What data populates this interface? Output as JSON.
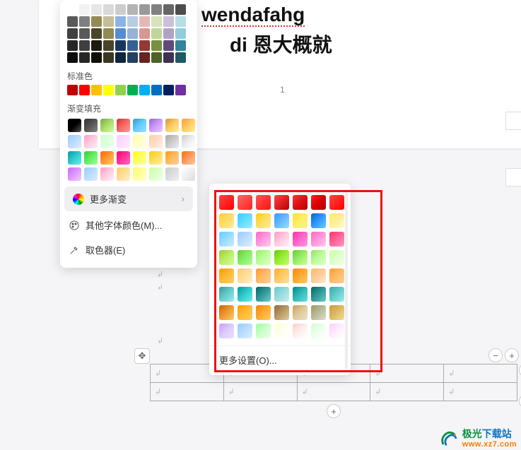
{
  "document": {
    "text1": "wendafahg",
    "text2": "di 恩大概就",
    "page_number": "1"
  },
  "color_panel": {
    "theme_rows": [
      [
        "#ffffff",
        "#f2f2f2",
        "#e6e6e6",
        "#d9d9d9",
        "#cccccc",
        "#b3b3b3",
        "#999999",
        "#808080",
        "#666666",
        "#4d4d4d"
      ],
      [
        "#595959",
        "#7f7f7f",
        "#948a54",
        "#c4bd97",
        "#8db3e2",
        "#b8cce4",
        "#e5b8b7",
        "#d7e3bc",
        "#ccc0d9",
        "#b6dde8"
      ],
      [
        "#404040",
        "#595959",
        "#4a452a",
        "#938953",
        "#548dd4",
        "#95b3d7",
        "#d99694",
        "#c2d69b",
        "#b2a1c7",
        "#92cddc"
      ],
      [
        "#262626",
        "#3f3f3f",
        "#1d1b10",
        "#494429",
        "#17365d",
        "#366092",
        "#953734",
        "#76923c",
        "#5f497a",
        "#31849b"
      ],
      [
        "#0d0d0d",
        "#262626",
        "#0f0e08",
        "#3b3720",
        "#0f243e",
        "#244061",
        "#632423",
        "#4f6228",
        "#3f3151",
        "#205867"
      ]
    ],
    "standard_label": "标准色",
    "standard_colors": [
      "#c00000",
      "#ff0000",
      "#ffc000",
      "#ffff00",
      "#92d050",
      "#00b050",
      "#00b0f0",
      "#0070c0",
      "#002060",
      "#7030a0"
    ],
    "gradient_label": "渐变填充",
    "gradient_presets": [
      [
        "#000",
        "#000",
        "#555"
      ],
      [
        "#333",
        "#555",
        "#888"
      ],
      [
        "#7a4",
        "#ad6",
        "#cf9"
      ],
      [
        "#c33",
        "#f66",
        "#f99"
      ],
      [
        "#39c",
        "#6cf",
        "#9df"
      ],
      [
        "#96c",
        "#c9f",
        "#ecf"
      ],
      [
        "#c93",
        "#fc6",
        "#fe9"
      ],
      [
        "#f93",
        "#fc6",
        "#fe9"
      ],
      [
        "#9cf",
        "#bdf",
        "#def"
      ],
      [
        "#f9c",
        "#fcd",
        "#fef"
      ],
      [
        "#cfc",
        "#dfd",
        "#efe"
      ],
      [
        "#fcf",
        "#fdf",
        "#fef"
      ],
      [
        "#ff9",
        "#ffc",
        "#ffe"
      ],
      [
        "#fc9",
        "#fdc",
        "#fee"
      ],
      [
        "#aaa",
        "#ccc",
        "#eee"
      ],
      [
        "#ccc",
        "#eee",
        "#fff"
      ],
      [
        "#09a",
        "#3cc",
        "#6ee"
      ],
      [
        "#3c3",
        "#6e6",
        "#9f9"
      ],
      [
        "#f60",
        "#f93",
        "#fc6"
      ],
      [
        "#f06",
        "#f39",
        "#f6c"
      ],
      [
        "#ff0",
        "#ff6",
        "#ff9"
      ],
      [
        "#fc0",
        "#fd6",
        "#fe9"
      ],
      [
        "#f90",
        "#fb6",
        "#fc9"
      ],
      [
        "#e70",
        "#f96",
        "#fc9"
      ],
      [
        "#c6f",
        "#d9f",
        "#ecf"
      ],
      [
        "#9cf",
        "#bdf",
        "#def"
      ],
      [
        "#f9c",
        "#fcd",
        "#fef"
      ],
      [
        "#fc6",
        "#fd9",
        "#fec"
      ],
      [
        "#ff6",
        "#ff9",
        "#ffc"
      ],
      [
        "#cf9",
        "#dfc",
        "#efd"
      ],
      [
        "#ccc",
        "#ddd",
        "#eee"
      ],
      [
        "#fff",
        "#eee",
        "#ddd"
      ]
    ],
    "more_gradient": "更多渐变",
    "more_font_color": "其他字体颜色(M)...",
    "eyedropper": "取色器(E)"
  },
  "gradient_popup": {
    "swatches": [
      [
        "#f44",
        "#f22",
        "#f00"
      ],
      [
        "#f66",
        "#f44",
        "#f22"
      ],
      [
        "#f55",
        "#f33",
        "#f11"
      ],
      [
        "#f44",
        "#d22",
        "#b00"
      ],
      [
        "#f33",
        "#d11",
        "#b00"
      ],
      [
        "#f22",
        "#d00",
        "#a00"
      ],
      [
        "#f44",
        "#f22",
        "#f00"
      ],
      [
        "#fc3",
        "#fd6",
        "#fe9"
      ],
      [
        "#3cf",
        "#6df",
        "#9ef"
      ],
      [
        "#fc0",
        "#fd6",
        "#fe9"
      ],
      [
        "#39f",
        "#6bf",
        "#9df"
      ],
      [
        "#fd3",
        "#fe6",
        "#fe9"
      ],
      [
        "#06c",
        "#39f",
        "#6cf"
      ],
      [
        "#fe6",
        "#fe9",
        "#ffc"
      ],
      [
        "#6cf",
        "#9df",
        "#cef"
      ],
      [
        "#9cf",
        "#bdf",
        "#def"
      ],
      [
        "#f6c",
        "#f9d",
        "#fce"
      ],
      [
        "#f9c",
        "#fcd",
        "#fef"
      ],
      [
        "#f39",
        "#f6c",
        "#f9d"
      ],
      [
        "#f6b",
        "#f9d",
        "#fce"
      ],
      [
        "#f36",
        "#f69",
        "#f9c"
      ],
      [
        "#9c3",
        "#be6",
        "#cf9"
      ],
      [
        "#6c3",
        "#8e6",
        "#af9"
      ],
      [
        "#9e6",
        "#bf9",
        "#dfc"
      ],
      [
        "#6c0",
        "#9e3",
        "#bf6"
      ],
      [
        "#6c3",
        "#9e6",
        "#cf9"
      ],
      [
        "#9d6",
        "#bf9",
        "#dfc"
      ],
      [
        "#cf9",
        "#dfc",
        "#efd"
      ],
      [
        "#f90",
        "#fb3",
        "#fc6"
      ],
      [
        "#fc6",
        "#fd9",
        "#fec"
      ],
      [
        "#f93",
        "#fb6",
        "#fc9"
      ],
      [
        "#fa3",
        "#fc6",
        "#fd9"
      ],
      [
        "#f80",
        "#fa3",
        "#fc6"
      ],
      [
        "#fb6",
        "#fc9",
        "#fec"
      ],
      [
        "#f93",
        "#fb6",
        "#fc9"
      ],
      [
        "#399",
        "#6cc",
        "#9ee"
      ],
      [
        "#099",
        "#3cc",
        "#6ee"
      ],
      [
        "#066",
        "#399",
        "#6cc"
      ],
      [
        "#6cc",
        "#9dd",
        "#cee"
      ],
      [
        "#088",
        "#3bb",
        "#6dd"
      ],
      [
        "#066",
        "#399",
        "#6cc"
      ],
      [
        "#3aa",
        "#6cc",
        "#9ee"
      ],
      [
        "#c60",
        "#e93",
        "#fc6"
      ],
      [
        "#f90",
        "#fb3",
        "#fc6"
      ],
      [
        "#e80",
        "#fa3",
        "#fc6"
      ],
      [
        "#963",
        "#b96",
        "#dc9"
      ],
      [
        "#c96",
        "#dc9",
        "#edc"
      ],
      [
        "#996",
        "#bb9",
        "#ddc"
      ],
      [
        "#c93",
        "#db6",
        "#ed9"
      ],
      [
        "#c9f",
        "#dcf",
        "#edf"
      ],
      [
        "#9cf",
        "#bdf",
        "#def"
      ],
      [
        "#9f9",
        "#cfc",
        "#efe"
      ],
      [
        "#ffc",
        "#ffe",
        "#fff"
      ],
      [
        "#fcc",
        "#fee",
        "#fff"
      ],
      [
        "#cfc",
        "#efe",
        "#fff"
      ],
      [
        "#fcf",
        "#fef",
        "#fff"
      ]
    ],
    "more_settings": "更多设置(O)..."
  },
  "table": {
    "rows": 2,
    "cols": 5,
    "cell_mark": "↲"
  },
  "watermark": {
    "name_cn": "极光下载站",
    "url": "www.xz7.com"
  }
}
